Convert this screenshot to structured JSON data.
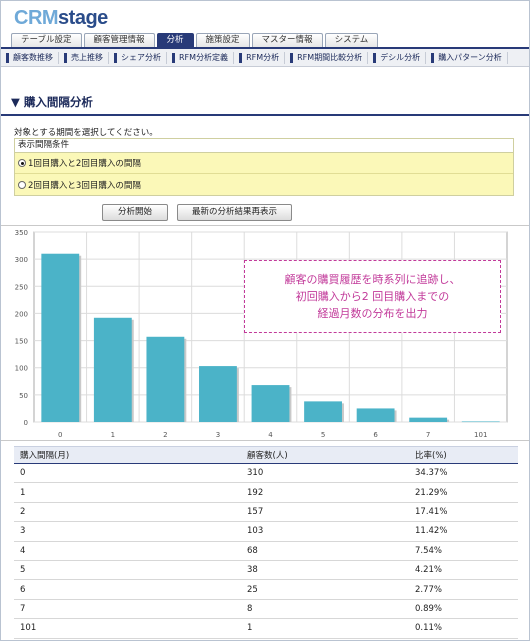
{
  "app": {
    "logo_crm": "CRM",
    "logo_stage": "stage"
  },
  "tabs": [
    {
      "label": "テーブル設定",
      "active": false
    },
    {
      "label": "顧客管理情報",
      "active": false
    },
    {
      "label": "分析",
      "active": true
    },
    {
      "label": "施策設定",
      "active": false
    },
    {
      "label": "マスター情報",
      "active": false
    },
    {
      "label": "システム",
      "active": false
    }
  ],
  "subnav": [
    "顧客数推移",
    "売上推移",
    "シェア分析",
    "RFM分析定義",
    "RFM分析",
    "RFM期間比較分析",
    "デシル分析",
    "購入パターン分析"
  ],
  "section": {
    "title": "▼ 購入間隔分析"
  },
  "instruction": "対象とする期間を選択してください。",
  "conditions": {
    "header": "表示間隔条件",
    "options": [
      {
        "label": "1回目購入と2回目購入の間隔",
        "selected": true
      },
      {
        "label": "2回目購入と3回目購入の間隔",
        "selected": false
      }
    ]
  },
  "buttons": {
    "start": "分析開始",
    "latest": "最新の分析結果再表示"
  },
  "callout": [
    "顧客の購買履歴を時系列に追跡し、",
    "初回購入から2 回目購入までの",
    "経過月数の分布を出力"
  ],
  "chart_data": {
    "type": "bar",
    "categories": [
      "0",
      "1",
      "2",
      "3",
      "4",
      "5",
      "6",
      "7",
      "101"
    ],
    "values": [
      310,
      192,
      157,
      103,
      68,
      38,
      25,
      8,
      1
    ],
    "ylim": [
      0,
      350
    ],
    "yticks": [
      0,
      50,
      100,
      150,
      200,
      250,
      300,
      350
    ],
    "bar_color": "#4bb3c8",
    "grid": true
  },
  "table": {
    "headers": [
      "購入間隔(月)",
      "顧客数(人)",
      "比率(%)"
    ],
    "rows": [
      [
        "0",
        "310",
        "34.37%"
      ],
      [
        "1",
        "192",
        "21.29%"
      ],
      [
        "2",
        "157",
        "17.41%"
      ],
      [
        "3",
        "103",
        "11.42%"
      ],
      [
        "4",
        "68",
        "7.54%"
      ],
      [
        "5",
        "38",
        "4.21%"
      ],
      [
        "6",
        "25",
        "2.77%"
      ],
      [
        "7",
        "8",
        "0.89%"
      ],
      [
        "101",
        "1",
        "0.11%"
      ]
    ]
  }
}
